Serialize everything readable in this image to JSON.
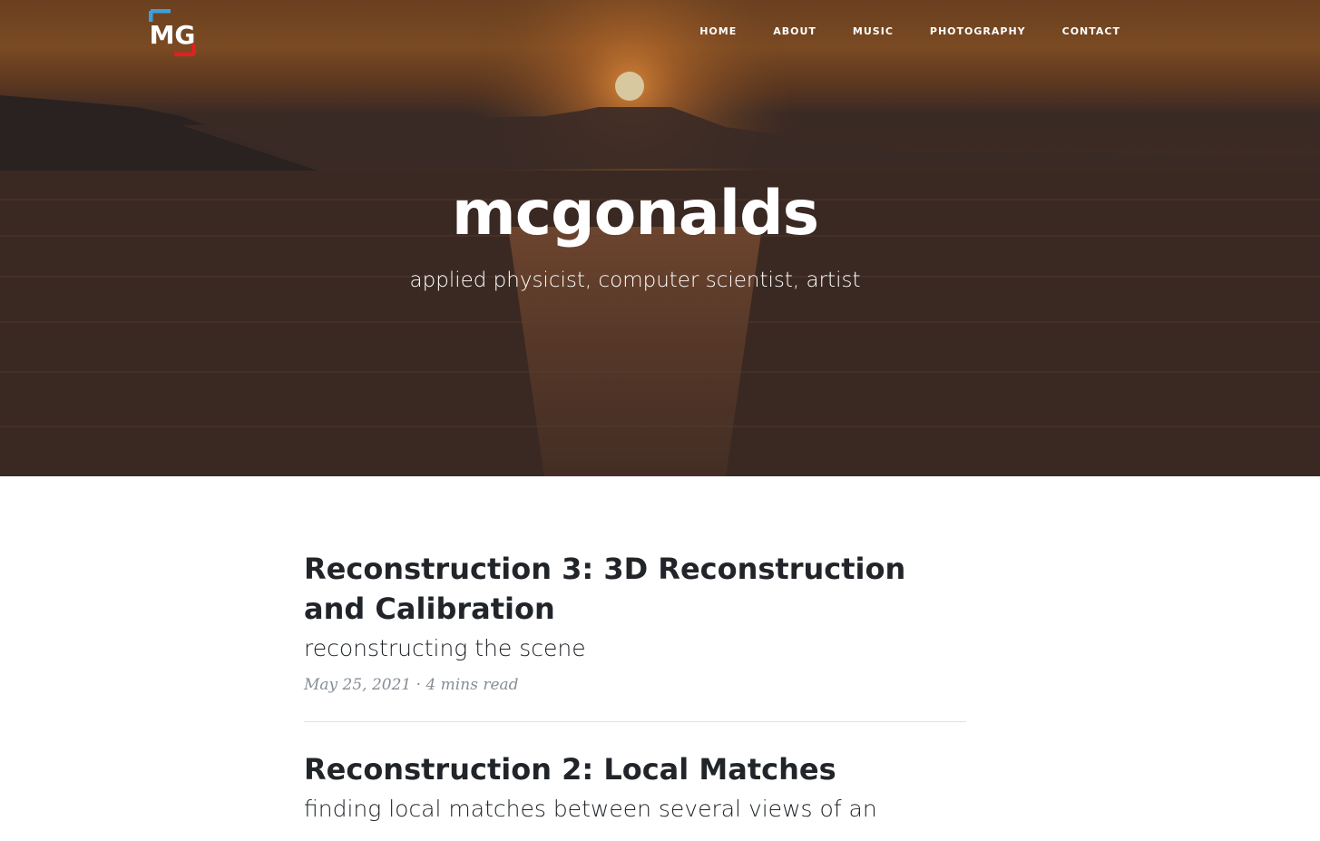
{
  "logo": {
    "text": "MG",
    "accent_blue": "#3aa0e0",
    "accent_red": "#e02020"
  },
  "nav": {
    "items": [
      {
        "label": "HOME"
      },
      {
        "label": "ABOUT"
      },
      {
        "label": "MUSIC"
      },
      {
        "label": "PHOTOGRAPHY"
      },
      {
        "label": "CONTACT"
      }
    ]
  },
  "hero": {
    "title": "mcgonalds",
    "subtitle": "applied physicist, computer scientist, artist"
  },
  "posts": [
    {
      "title": "Reconstruction 3: 3D Reconstruction and Calibration",
      "subtitle": "reconstructing the scene",
      "meta": "May 25, 2021 · 4 mins read"
    },
    {
      "title": "Reconstruction 2: Local Matches",
      "subtitle": "finding local matches between several views of an"
    }
  ]
}
